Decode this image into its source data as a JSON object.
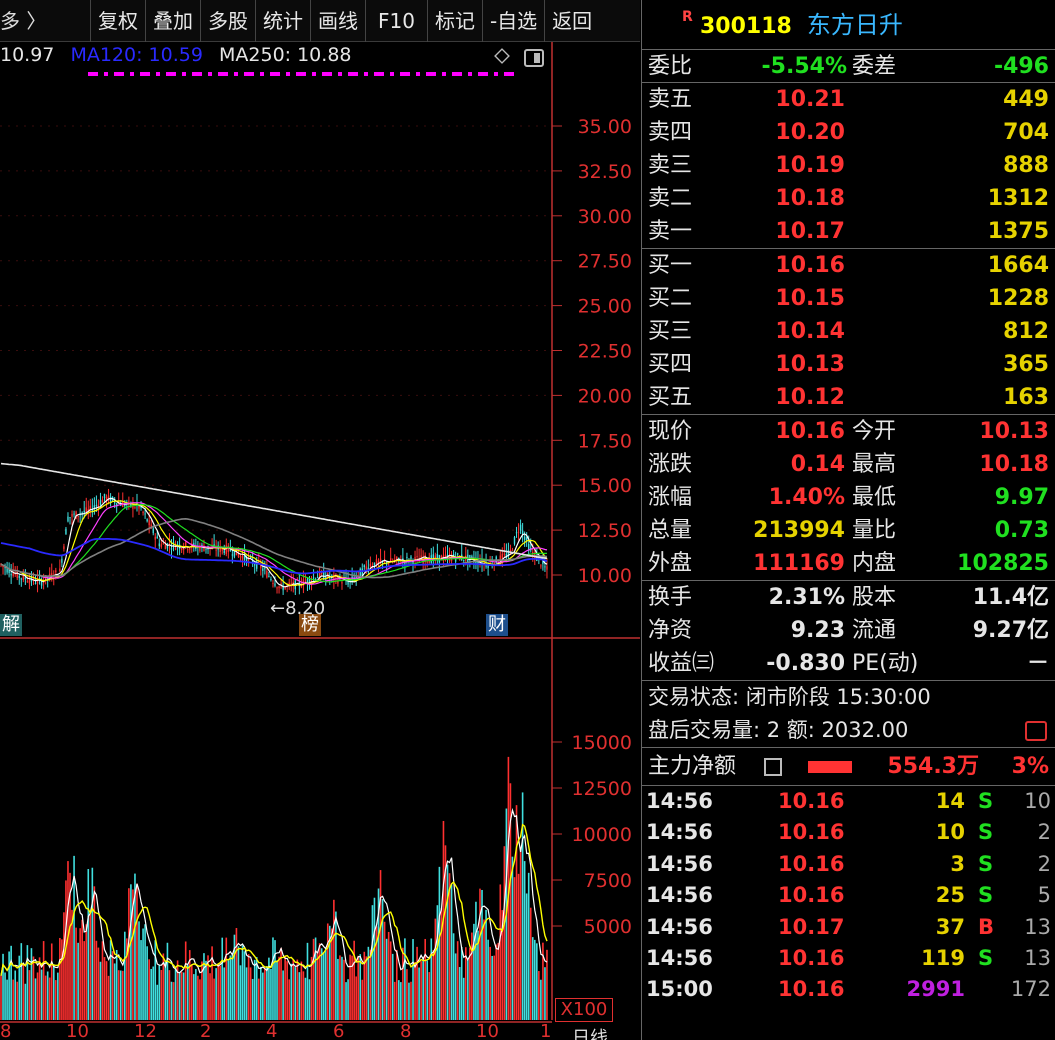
{
  "toolbar": {
    "left_text": "多 〉",
    "items": [
      "复权",
      "叠加",
      "多股",
      "统计",
      "画线",
      "F10",
      "标记",
      "-自选",
      "返回"
    ]
  },
  "ma_legend": [
    {
      "text": "10.97",
      "color": "#e6e6e6"
    },
    {
      "text": "MA120: 10.59",
      "color": "#2a2aff"
    },
    {
      "text": "MA250: 10.88",
      "color": "#e6e6e6"
    }
  ],
  "price_axis": [
    "35.00",
    "32.50",
    "30.00",
    "27.50",
    "25.00",
    "22.50",
    "20.00",
    "17.50",
    "15.00",
    "12.50",
    "10.00"
  ],
  "volume_axis": [
    "15000",
    "12500",
    "10000",
    "7500",
    "5000"
  ],
  "volume_unit": "X100",
  "x_axis": [
    "8",
    "10",
    "12",
    "2",
    "4",
    "6",
    "8",
    "10",
    "1"
  ],
  "period_label": "日线",
  "markers": {
    "jie": "解",
    "bang": "榜",
    "cai": "财"
  },
  "low_label": "←8.20",
  "stock": {
    "badge": "R",
    "code": "300118",
    "name": "东方日升"
  },
  "weibi": {
    "label": "委比",
    "value": "-5.54%",
    "label2": "委差",
    "value2": "-496"
  },
  "asks": [
    {
      "label": "卖五",
      "price": "10.21",
      "vol": "449"
    },
    {
      "label": "卖四",
      "price": "10.20",
      "vol": "704"
    },
    {
      "label": "卖三",
      "price": "10.19",
      "vol": "888"
    },
    {
      "label": "卖二",
      "price": "10.18",
      "vol": "1312"
    },
    {
      "label": "卖一",
      "price": "10.17",
      "vol": "1375"
    }
  ],
  "bids": [
    {
      "label": "买一",
      "price": "10.16",
      "vol": "1664"
    },
    {
      "label": "买二",
      "price": "10.15",
      "vol": "1228"
    },
    {
      "label": "买三",
      "price": "10.14",
      "vol": "812"
    },
    {
      "label": "买四",
      "price": "10.13",
      "vol": "365"
    },
    {
      "label": "买五",
      "price": "10.12",
      "vol": "163"
    }
  ],
  "stats": [
    {
      "l1": "现价",
      "v1": "10.16",
      "c1": "red",
      "l2": "今开",
      "v2": "10.13",
      "c2": "red"
    },
    {
      "l1": "涨跌",
      "v1": "0.14",
      "c1": "red",
      "l2": "最高",
      "v2": "10.18",
      "c2": "red"
    },
    {
      "l1": "涨幅",
      "v1": "1.40%",
      "c1": "red",
      "l2": "最低",
      "v2": "9.97",
      "c2": "green"
    },
    {
      "l1": "总量",
      "v1": "213994",
      "c1": "yellow",
      "l2": "量比",
      "v2": "0.73",
      "c2": "green"
    },
    {
      "l1": "外盘",
      "v1": "111169",
      "c1": "red",
      "l2": "内盘",
      "v2": "102825",
      "c2": "green"
    }
  ],
  "finance": [
    {
      "l1": "换手",
      "v1": "2.31%",
      "l2": "股本",
      "v2": "11.4亿"
    },
    {
      "l1": "净资",
      "v1": "9.23",
      "l2": "流通",
      "v2": "9.27亿"
    },
    {
      "l1": "收益㈢",
      "v1": "-0.830",
      "l2": "PE(动)",
      "v2": "－"
    }
  ],
  "trade_state": {
    "line1": "交易状态: 闭市阶段 15:30:00",
    "line2": "盘后交易量: 2  额: 2032.00"
  },
  "main_flow": {
    "label": "主力净额",
    "value": "554.3万",
    "pct": "3%"
  },
  "ticks": [
    {
      "time": "14:56",
      "price": "10.16",
      "qty": "14",
      "qc": "yellow",
      "bs": "S",
      "bsc": "green",
      "n": "10"
    },
    {
      "time": "14:56",
      "price": "10.16",
      "qty": "10",
      "qc": "yellow",
      "bs": "S",
      "bsc": "green",
      "n": "2"
    },
    {
      "time": "14:56",
      "price": "10.16",
      "qty": "3",
      "qc": "yellow",
      "bs": "S",
      "bsc": "green",
      "n": "2"
    },
    {
      "time": "14:56",
      "price": "10.16",
      "qty": "25",
      "qc": "yellow",
      "bs": "S",
      "bsc": "green",
      "n": "5"
    },
    {
      "time": "14:56",
      "price": "10.17",
      "qty": "37",
      "qc": "yellow",
      "bs": "B",
      "bsc": "red",
      "n": "13"
    },
    {
      "time": "14:56",
      "price": "10.16",
      "qty": "119",
      "qc": "yellow",
      "bs": "S",
      "bsc": "green",
      "n": "13"
    },
    {
      "time": "15:00",
      "price": "10.16",
      "qty": "2991",
      "qc": "purple",
      "bs": "",
      "bsc": "green",
      "n": "172"
    }
  ]
}
